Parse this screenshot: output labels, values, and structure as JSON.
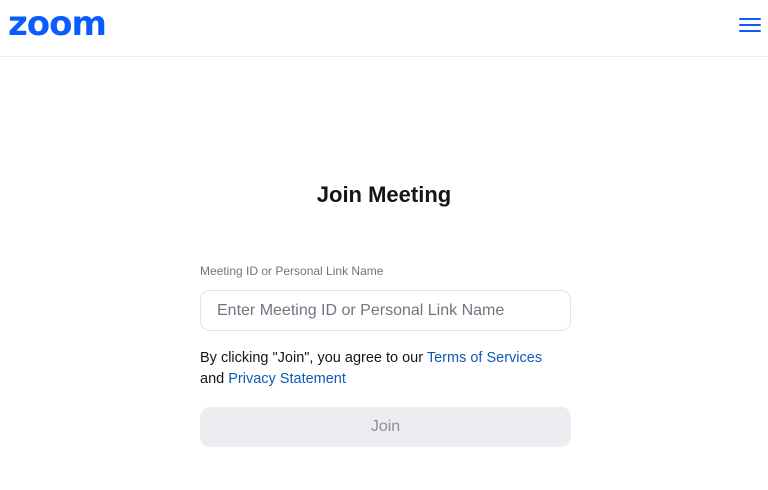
{
  "header": {
    "logo_text": "zoom",
    "menu_icon": "hamburger-menu-icon"
  },
  "main": {
    "title": "Join Meeting",
    "field_label": "Meeting ID or Personal Link Name",
    "input_placeholder": "Enter Meeting ID or Personal Link Name",
    "input_value": "",
    "agreement_prefix": "By clicking \"Join\", you agree to our ",
    "terms_link": "Terms of Services",
    "agreement_and": "and ",
    "privacy_link": "Privacy Statement",
    "join_label": "Join"
  },
  "colors": {
    "brand": "#0b5cff",
    "link": "#0e5bb5",
    "button_disabled_bg": "#ededf1"
  }
}
